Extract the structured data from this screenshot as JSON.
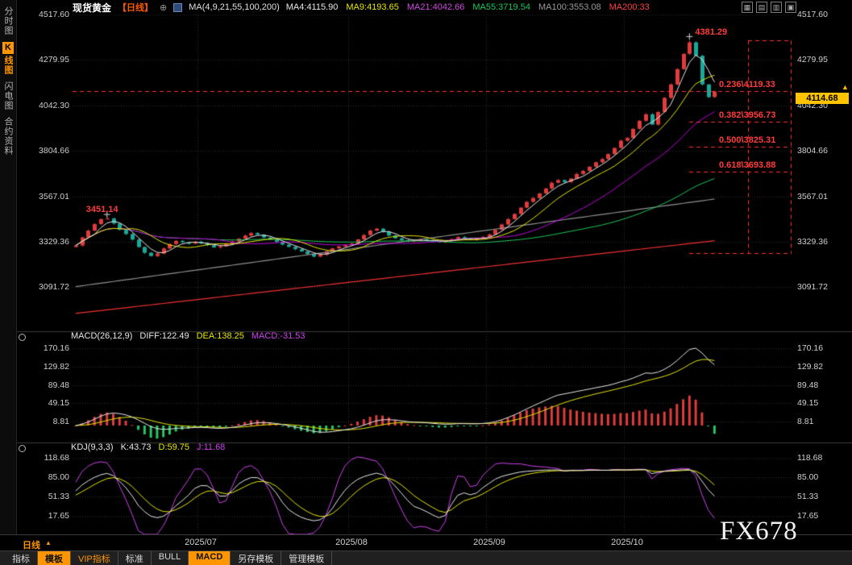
{
  "topbar": {
    "symbol": "现货黄金",
    "period": "【日线】",
    "expand_icon": "⊕",
    "ma_settings": "MA(4,9,21,55,100,200)",
    "ma_values": [
      {
        "text": "MA4:4115.90",
        "color": "#e8e8e8"
      },
      {
        "text": "MA9:4193.65",
        "color": "#e6e600"
      },
      {
        "text": "MA21:4042.66",
        "color": "#d24ae0"
      },
      {
        "text": "MA55:3719.54",
        "color": "#19c85a"
      },
      {
        "text": "MA100:3553.08",
        "color": "#9a9a9a"
      },
      {
        "text": "MA200:33",
        "color": "#ff4040"
      }
    ],
    "window_icons": [
      "▦",
      "▤",
      "▥",
      "▣"
    ]
  },
  "sidebar": {
    "items": [
      {
        "label": "分时图",
        "active": false
      },
      {
        "label": "K线图",
        "active": true
      },
      {
        "label": "闪电图",
        "active": false
      },
      {
        "label": "合约资料",
        "active": false
      }
    ]
  },
  "indicators": {
    "macd": {
      "title": "MACD(26,12,9)",
      "diff": "DIFF:122.49",
      "dea": "DEA:138.25",
      "macd": "MACD:-31.53"
    },
    "kdj": {
      "title": "KDJ(9,3,3)",
      "k": "K:43.73",
      "d": "D:59.75",
      "j": "J:11.68"
    }
  },
  "xaxis": {
    "period_label": "日线",
    "period_arrow": "▲"
  },
  "bottom_toolbar": {
    "tabs": [
      {
        "label": "指标",
        "style": "plain"
      },
      {
        "label": "模板",
        "style": "orange-bg"
      },
      {
        "label": "VIP指标",
        "style": "orange-text"
      },
      {
        "label": "标准",
        "style": "plain"
      },
      {
        "label": "BULL",
        "style": "plain"
      },
      {
        "label": "MACD",
        "style": "orange-bg"
      },
      {
        "label": "另存模板",
        "style": "plain"
      },
      {
        "label": "管理模板",
        "style": "plain"
      }
    ]
  },
  "watermark": "FX678",
  "chart_data": {
    "type": "candlestick",
    "symbol": "现货黄金",
    "timeframe": "日线",
    "closes": [
      3310,
      3352,
      3388,
      3422,
      3448,
      3451,
      3425,
      3392,
      3370,
      3341,
      3302,
      3272,
      3255,
      3268,
      3295,
      3318,
      3334,
      3327,
      3320,
      3330,
      3322,
      3312,
      3300,
      3306,
      3318,
      3331,
      3346,
      3362,
      3375,
      3367,
      3352,
      3341,
      3329,
      3315,
      3303,
      3291,
      3279,
      3266,
      3252,
      3262,
      3280,
      3295,
      3305,
      3312,
      3320,
      3342,
      3365,
      3388,
      3398,
      3382,
      3362,
      3348,
      3338,
      3331,
      3336,
      3342,
      3337,
      3331,
      3328,
      3334,
      3344,
      3354,
      3347,
      3340,
      3346,
      3355,
      3368,
      3392,
      3420,
      3448,
      3475,
      3508,
      3538,
      3558,
      3582,
      3608,
      3638,
      3652,
      3642,
      3660,
      3684,
      3700,
      3722,
      3745,
      3762,
      3788,
      3820,
      3858,
      3872,
      3920,
      3962,
      3996,
      3942,
      4008,
      4082,
      4152,
      4232,
      4312,
      4372,
      4302,
      4152,
      4086,
      4115
    ],
    "months": [
      {
        "label": "2025/07",
        "index": 20
      },
      {
        "label": "2025/08",
        "index": 44
      },
      {
        "label": "2025/09",
        "index": 66
      },
      {
        "label": "2025/10",
        "index": 88
      }
    ],
    "price_panel": {
      "ylim": [
        2865.9,
        4517.6
      ],
      "ticks": [
        {
          "v": 4517.6,
          "label": "4517.60"
        },
        {
          "v": 4279.95,
          "label": "4279.95"
        },
        {
          "v": 4042.3,
          "label": "4042.30"
        },
        {
          "v": 3804.66,
          "label": "3804.66"
        },
        {
          "v": 3567.01,
          "label": "3567.01"
        },
        {
          "v": 3329.36,
          "label": "3329.36"
        },
        {
          "v": 3091.72,
          "label": "3091.72"
        }
      ]
    },
    "macd_panel": {
      "ylim": [
        -32.0,
        182.6
      ],
      "ticks": [
        {
          "v": 170.16,
          "label": "170.16"
        },
        {
          "v": 129.82,
          "label": "129.82"
        },
        {
          "v": 89.48,
          "label": "89.48"
        },
        {
          "v": 49.15,
          "label": "49.15"
        },
        {
          "v": 8.81,
          "label": "8.81"
        }
      ]
    },
    "kdj_panel": {
      "ylim": [
        -14.6,
        125.7
      ],
      "ticks": [
        {
          "v": 118.68,
          "label": "118.68"
        },
        {
          "v": 85.0,
          "label": "85.00"
        },
        {
          "v": 51.33,
          "label": "51.33"
        },
        {
          "v": 17.65,
          "label": "17.65"
        }
      ]
    },
    "annotations": [
      {
        "label": "3451.14",
        "index": 5,
        "price": 3451.14
      },
      {
        "label": "4381.29",
        "index": 98,
        "price": 4381.29
      }
    ],
    "last_price": {
      "label": "4114.68",
      "value": 4114.68,
      "arrow_glyph": "▲"
    },
    "fib": {
      "high": 4381.29,
      "low": 3271.23,
      "levels": [
        {
          "label": "0.236\\4119.33",
          "value": 4119.33
        },
        {
          "label": "0.382\\3956.73",
          "value": 3956.73
        },
        {
          "label": "0.500\\3825.31",
          "value": 3825.31
        },
        {
          "label": "0.618\\3693.88",
          "value": 3693.88
        }
      ]
    },
    "ma_long": {
      "ma100": [
        3095,
        3553
      ],
      "ma200": [
        2955,
        3335
      ]
    },
    "colors": {
      "up": "#e03c3c",
      "down": "#1aa89a",
      "grid": "#2d2d2d",
      "divider": "#3c3c3c",
      "ma4": "#e8e8e8",
      "ma9": "#e6e600",
      "ma21": "#c000e0",
      "ma55": "#19c85a",
      "ma100": "#909090",
      "ma200": "#f03030",
      "fib": "#ff3030",
      "diff": "#e8e8e8",
      "dea": "#e6e600",
      "hist_up": "#e03c3c",
      "hist_down": "#22c864",
      "k": "#e8e8e8",
      "d": "#e6e600",
      "j": "#d040f0",
      "cross": "#d8d8d8"
    }
  }
}
